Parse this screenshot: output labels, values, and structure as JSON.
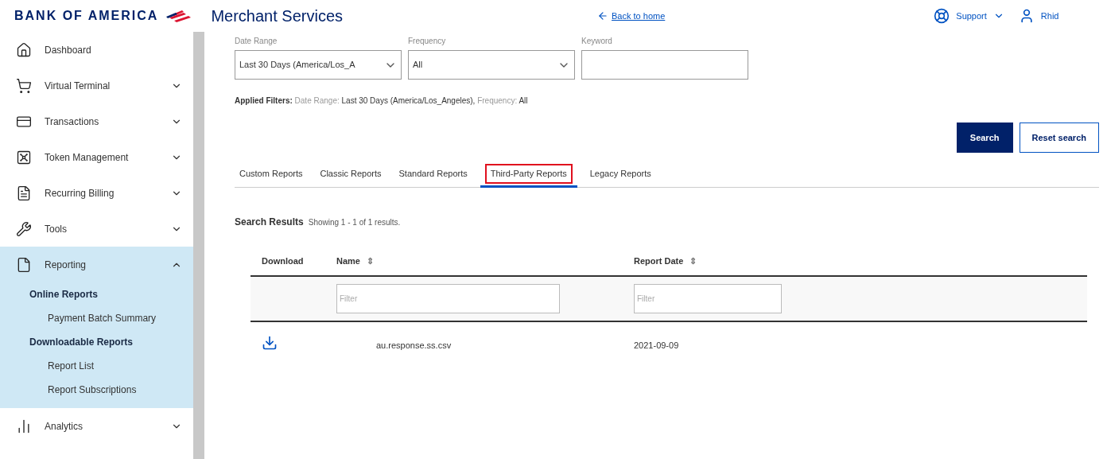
{
  "header": {
    "brand": "BANK OF AMERICA",
    "app_title": "Merchant Services",
    "back_link": "Back to home",
    "support": "Support",
    "user": "Rhid"
  },
  "sidebar": {
    "items": [
      {
        "label": "Dashboard"
      },
      {
        "label": "Virtual Terminal",
        "expanded": false
      },
      {
        "label": "Transactions",
        "expanded": false
      },
      {
        "label": "Token Management",
        "expanded": false
      },
      {
        "label": "Recurring Billing",
        "expanded": false
      },
      {
        "label": "Tools",
        "expanded": false
      },
      {
        "label": "Reporting",
        "expanded": true,
        "children": [
          {
            "label": "Online Reports",
            "children": [
              {
                "label": "Payment Batch Summary"
              }
            ]
          },
          {
            "label": "Downloadable Reports",
            "children": [
              {
                "label": "Report List"
              },
              {
                "label": "Report Subscriptions"
              }
            ]
          }
        ]
      },
      {
        "label": "Analytics",
        "expanded": false
      }
    ]
  },
  "filters": {
    "fields": [
      {
        "kind": "select",
        "label": "Date Range",
        "value": "Last 30 Days (America/Los_A"
      },
      {
        "kind": "select",
        "label": "Frequency",
        "value": "All"
      },
      {
        "kind": "text",
        "label": "Keyword"
      }
    ],
    "applied_label": "Applied Filters:",
    "applied": [
      {
        "name": "Date Range:",
        "value": "Last 30 Days (America/Los_Angeles),"
      },
      {
        "name": "Frequency:",
        "value": "All"
      }
    ],
    "buttons": [
      {
        "kind": "primary",
        "label": "Search"
      },
      {
        "kind": "secondary",
        "label": "Reset search"
      }
    ]
  },
  "tabs": [
    {
      "label": "Custom Reports",
      "selected": false
    },
    {
      "label": "Classic Reports",
      "selected": false
    },
    {
      "label": "Standard Reports",
      "selected": false
    },
    {
      "label": "Third-Party Reports",
      "selected": true
    },
    {
      "label": "Legacy Reports",
      "selected": false
    }
  ],
  "results": {
    "title": "Search Results",
    "summary": "Showing 1 - 1 of 1 results.",
    "columns": [
      {
        "label": "Download"
      },
      {
        "label": "Name",
        "sort_icon": "⇕",
        "filter_placeholder": "Filter"
      },
      {
        "label": "Report Date",
        "sort_icon": "⇕",
        "filter_placeholder": "Filter"
      }
    ],
    "rows": [
      {
        "name": "au.response.ss.csv",
        "report_date": "2021-09-09"
      }
    ]
  }
}
